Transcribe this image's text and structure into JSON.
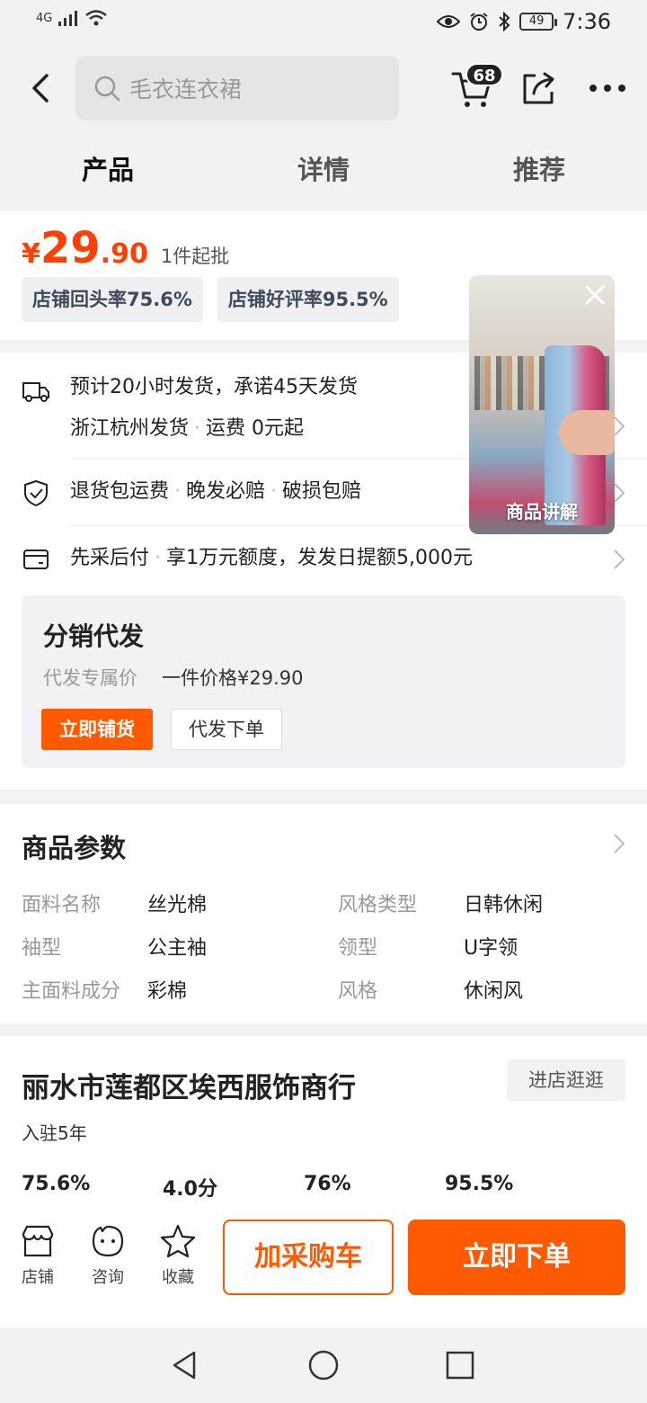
{
  "status_bar": {
    "network": "4G",
    "battery": "49",
    "time": "7:36"
  },
  "search": {
    "placeholder": "毛衣连衣裙"
  },
  "header": {
    "cart_count": "68"
  },
  "tabs": [
    {
      "label": "产品",
      "active": true
    },
    {
      "label": "详情",
      "active": false
    },
    {
      "label": "推荐",
      "active": false
    }
  ],
  "price": {
    "currency": "¥",
    "integer": "29",
    "decimal": ".90",
    "moq": "1件起批"
  },
  "rates": {
    "repurchase": "店铺回头率75.6%",
    "positive": "店铺好评率95.5%"
  },
  "video": {
    "label": "商品讲解"
  },
  "service": {
    "shipping_line1": "预计20小时发货，承诺45天发货",
    "origin": "浙江杭州发货",
    "fee": "运费 0元起",
    "guarantee": [
      "退货包运费",
      "晚发必赔",
      "破损包赔"
    ],
    "pay_later": "先采后付",
    "pay_later_detail": "享1万元额度，发发日提额5,000元"
  },
  "distribution": {
    "title": "分销代发",
    "label": "代发专属价",
    "price_text": "一件价格¥29.90",
    "btn_stock": "立即铺货",
    "btn_dropship": "代发下单"
  },
  "params": {
    "title": "商品参数",
    "items": [
      {
        "key": "面料名称",
        "value": "丝光棉"
      },
      {
        "key": "风格类型",
        "value": "日韩休闲"
      },
      {
        "key": "袖型",
        "value": "公主袖"
      },
      {
        "key": "领型",
        "value": "U字领"
      },
      {
        "key": "主面料成分",
        "value": "彩棉"
      },
      {
        "key": "风格",
        "value": "休闲风"
      }
    ]
  },
  "shop": {
    "name": "丽水市莲都区埃西服饰商行",
    "enter": "进店逛逛",
    "since": "入驻5年",
    "stats": [
      "75.6%",
      "4.0分",
      "76%",
      "95.5%"
    ]
  },
  "action_bar": {
    "store": "店铺",
    "consult": "咨询",
    "favorite": "收藏",
    "add_cart": "加采购车",
    "buy_now": "立即下单"
  },
  "colors": {
    "accent": "#ff5a00",
    "price": "#ff4000"
  }
}
